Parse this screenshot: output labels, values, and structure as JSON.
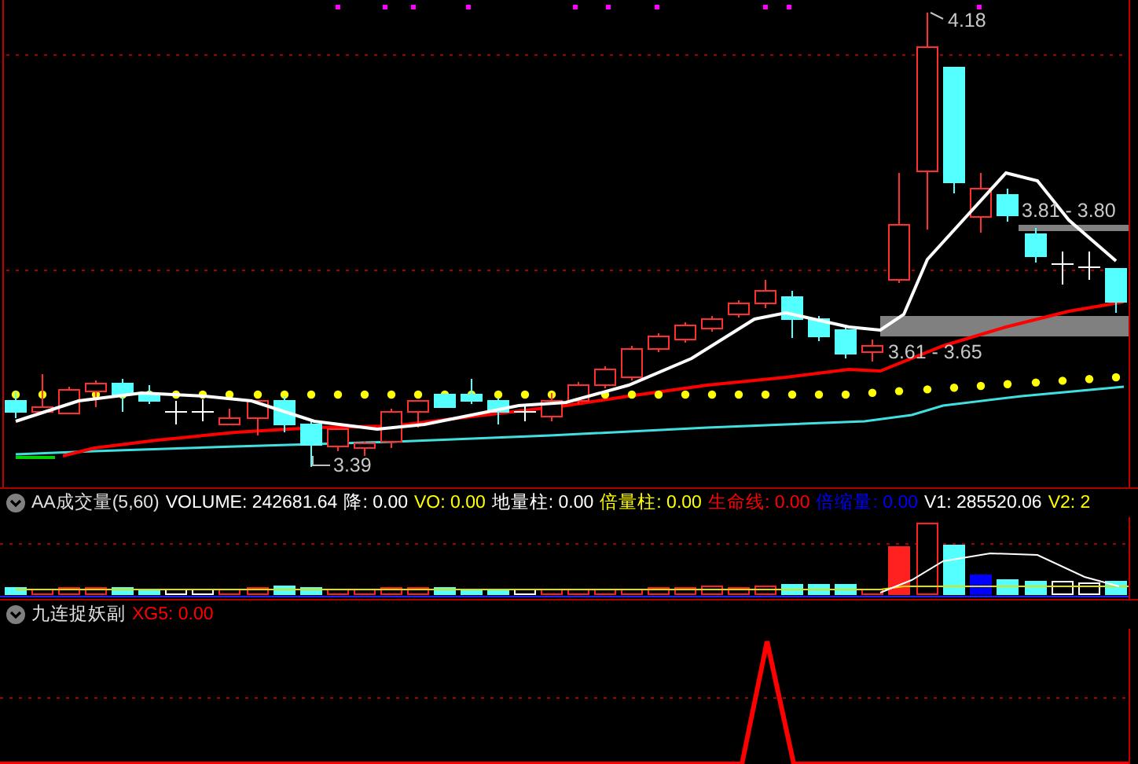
{
  "main_chart": {
    "labels": [
      {
        "text": "4.18"
      },
      {
        "text": "3.81 - 3.80"
      },
      {
        "text": "3.61 - 3.65"
      },
      {
        "text": "3.39"
      }
    ]
  },
  "indicators": [
    {
      "title": "AA成交量(5,60)",
      "items": [
        {
          "text": "VOLUME: 242681.64",
          "color": "#ffffff"
        },
        {
          "text": "降: 0.00",
          "color": "#ffffff"
        },
        {
          "text": "VO: 0.00",
          "color": "#ffff00"
        },
        {
          "text": "地量柱: 0.00",
          "color": "#ffffff"
        },
        {
          "text": "倍量柱: 0.00",
          "color": "#ffff00"
        },
        {
          "text": "生命线: 0.00",
          "color": "#ff0000"
        },
        {
          "text": "倍缩量: 0.00",
          "color": "#0000ff"
        },
        {
          "text": "V1: 285520.06",
          "color": "#ffffff"
        },
        {
          "text": "V2: 2",
          "color": "#ffff00"
        }
      ]
    },
    {
      "title": "九连捉妖副",
      "items": [
        {
          "text": "XG5: 0.00",
          "color": "#ff0000"
        }
      ]
    }
  ]
}
